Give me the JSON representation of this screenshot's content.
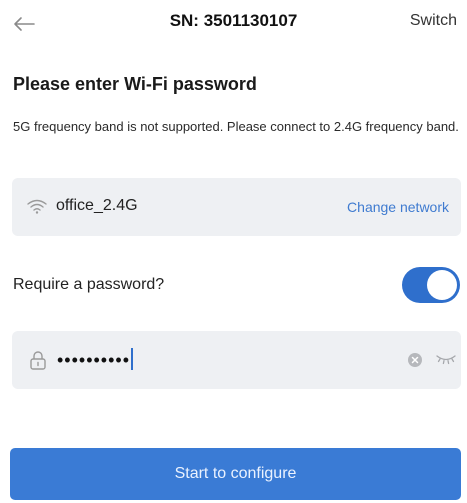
{
  "header": {
    "title": "SN: 3501130107",
    "right_action": "Switch",
    "back_icon": "arrow-left-icon"
  },
  "main": {
    "heading": "Please enter Wi-Fi password",
    "note": "5G frequency band is not supported. Please connect to 2.4G frequency band."
  },
  "network": {
    "icon": "wifi-icon",
    "ssid": "office_2.4G",
    "change_label": "Change network"
  },
  "require_password": {
    "label": "Require a password?",
    "enabled": true
  },
  "password_field": {
    "value": "••••••••••",
    "icons": [
      "lock-icon",
      "clear-icon",
      "eye-closed-icon"
    ]
  },
  "actions": {
    "primary_label": "Start to configure"
  },
  "colors": {
    "accent": "#3a7bd5",
    "link": "#3f7bd0",
    "field_bg": "#eef0f3"
  }
}
